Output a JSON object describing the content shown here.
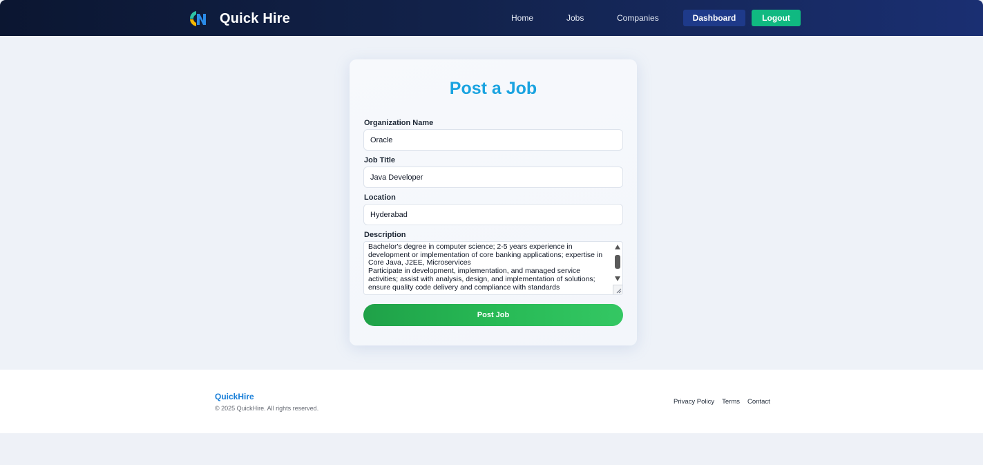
{
  "navbar": {
    "brand": "Quick Hire",
    "links": {
      "home": "Home",
      "jobs": "Jobs",
      "companies": "Companies"
    },
    "dashboard_label": "Dashboard",
    "logout_label": "Logout"
  },
  "form": {
    "title": "Post a Job",
    "organization": {
      "label": "Organization Name",
      "value": "Oracle"
    },
    "job_title": {
      "label": "Job Title",
      "value": "Java Developer"
    },
    "location": {
      "label": "Location",
      "value": "Hyderabad"
    },
    "description": {
      "label": "Description",
      "value": "Bachelor's degree in computer science; 2-5 years experience in\ndevelopment or implementation of core banking applications; expertise in\nCore Java, J2EE, Microservices\nParticipate in development, implementation, and managed service\nactivities; assist with analysis, design, and implementation of solutions;\nensure quality code delivery and compliance with standards"
    },
    "submit_label": "Post Job"
  },
  "footer": {
    "brand": "QuickHire",
    "copyright": "© 2025 QuickHire. All rights reserved.",
    "links": {
      "privacy": "Privacy Policy",
      "terms": "Terms",
      "contact": "Contact"
    }
  },
  "colors": {
    "accent_title": "#1aa3e0",
    "logout_green": "#10b981",
    "dashboard_blue": "#1e3a8a",
    "post_button_green": "#27b955",
    "footer_brand_blue": "#1a7fd8"
  },
  "icons": {
    "logo": "quickhire-logo-icon",
    "textarea_scroll": "scrollbar",
    "resize": "resize-grip-icon"
  }
}
